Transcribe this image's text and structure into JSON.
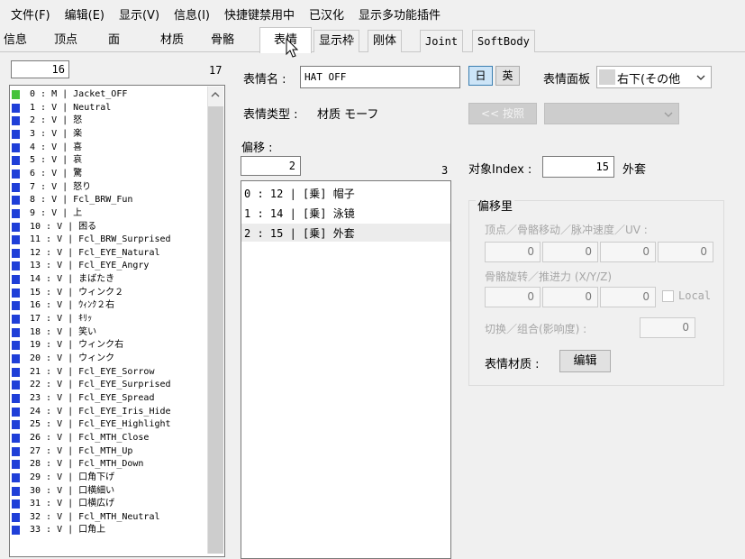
{
  "menu": [
    "文件(F)",
    "编辑(E)",
    "显示(V)",
    "信息(I)",
    "快捷键禁用中",
    "已汉化",
    "显示多功能插件"
  ],
  "tabs": [
    "信息",
    "顶点",
    "面",
    "材质",
    "骨骼",
    "表情",
    "显示枠",
    "刚体",
    "Joint",
    "SoftBody"
  ],
  "left": {
    "index_value": "16",
    "count": "17",
    "items": [
      "0 : M | Jacket_OFF",
      "1 : V | Neutral",
      "2 : V | 怒",
      "3 : V | 楽",
      "4 : V | 喜",
      "5 : V | 哀",
      "6 : V | 驚",
      "7 : V | 怒り",
      "8 : V | Fcl_BRW_Fun",
      "9 : V | 上",
      "10 : V | 困る",
      "11 : V | Fcl_BRW_Surprised",
      "12 : V | Fcl_EYE_Natural",
      "13 : V | Fcl_EYE_Angry",
      "14 : V | まばたき",
      "15 : V | ウィンク２",
      "16 : V | ｳｨﾝｸ２右",
      "17 : V | ｷﾘｯ",
      "18 : V | 笑い",
      "19 : V | ウィンク右",
      "20 : V | ウィンク",
      "21 : V | Fcl_EYE_Sorrow",
      "22 : V | Fcl_EYE_Surprised",
      "23 : V | Fcl_EYE_Spread",
      "24 : V | Fcl_EYE_Iris_Hide",
      "25 : V | Fcl_EYE_Highlight",
      "26 : V | Fcl_MTH_Close",
      "27 : V | Fcl_MTH_Up",
      "28 : V | Fcl_MTH_Down",
      "29 : V | 口角下げ",
      "30 : V | 口横細い",
      "31 : V | 口横広げ",
      "32 : V | Fcl_MTH_Neutral",
      "33 : V | 口角上"
    ]
  },
  "morph": {
    "name_label": "表情名 :",
    "name_value": "HAT OFF",
    "jp_btn": "日",
    "en_btn": "英",
    "panel_label": "表情面板",
    "panel_value": "右下(その他",
    "type_label": "表情类型 :",
    "type_value": "材质 モーフ",
    "nav_btn": "<< 按照",
    "offset_label": "偏移 :",
    "offset_value": "2",
    "offset_count": "3",
    "offsets": [
      "0 : 12 | [乗] 帽子",
      "1 : 14 | [乗] 泳镜",
      "2 : 15 | [乗] 外套"
    ],
    "target_label": "对象Index :",
    "target_value": "15",
    "target_name": "外套",
    "group_title": "偏移里",
    "vertex_label": "顶点／骨骼移动／脉冲速度／UV :",
    "vertex_values": [
      "0",
      "0",
      "0",
      "0"
    ],
    "bone_label": "骨骼旋转／推进力 (X/Y/Z)",
    "bone_values": [
      "0",
      "0",
      "0"
    ],
    "local_label": "Local",
    "switch_label": "切换／组合(影响度) :",
    "switch_value": "0",
    "material_label": "表情材质 :",
    "edit_btn": "编辑"
  }
}
